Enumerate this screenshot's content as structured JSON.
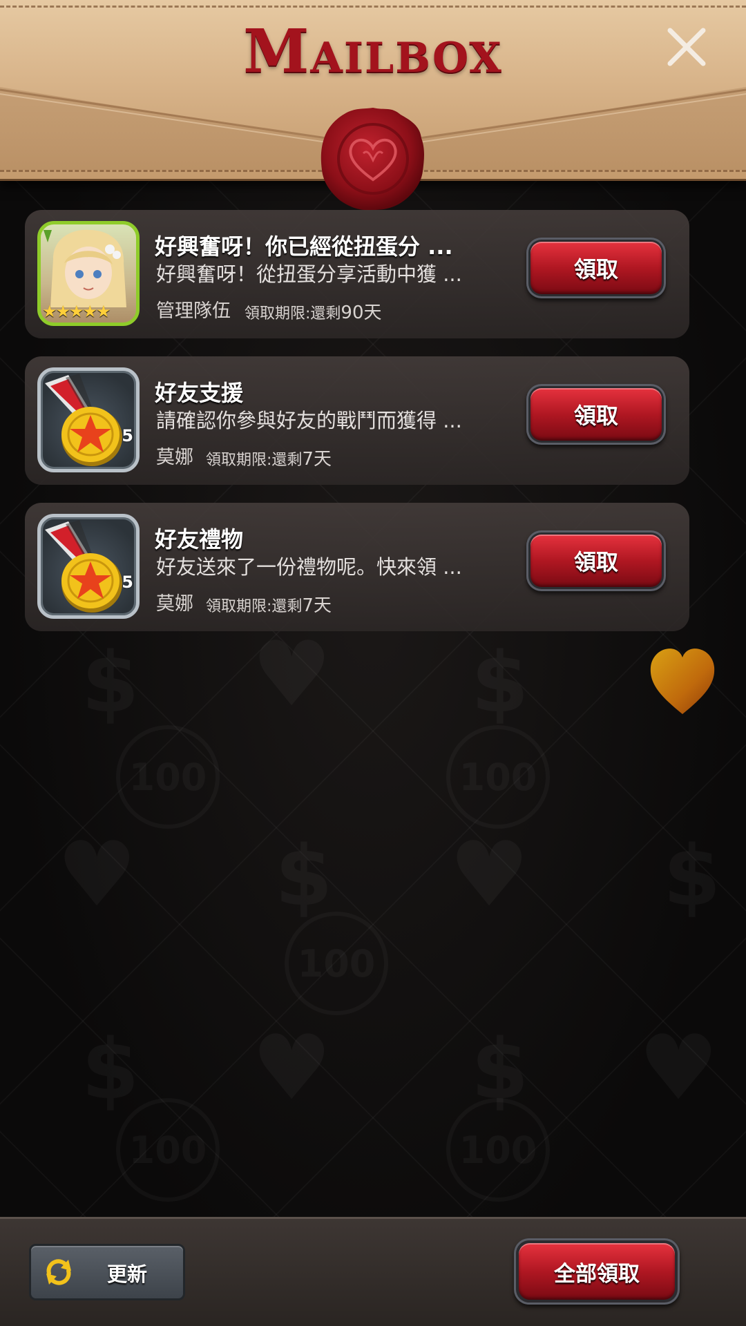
{
  "header": {
    "title": "Mailbox",
    "close_icon": "close-icon",
    "seal_icon": "wax-seal-heart-icon"
  },
  "mails": [
    {
      "title": "好興奮呀！你已經從扭蛋分 ...",
      "description": "好興奮呀！從扭蛋分享活動中獲 ...",
      "sender": "管理隊伍",
      "expiry_label": "領取期限:還剩",
      "expiry_days": "90天",
      "claim_label": "領取",
      "icon": "hero-portrait-icon",
      "stars": "★★★★★"
    },
    {
      "title": "好友支援",
      "description": "請確認你參與好友的戰鬥而獲得 ...",
      "sender": "莫娜",
      "expiry_label": "領取期限:還剩",
      "expiry_days": "7天",
      "claim_label": "領取",
      "icon": "gold-medal-icon",
      "badge": "5"
    },
    {
      "title": "好友禮物",
      "description": "好友送來了一份禮物呢。快來領 ...",
      "sender": "莫娜",
      "expiry_label": "領取期限:還剩",
      "expiry_days": "7天",
      "claim_label": "領取",
      "icon": "gold-medal-icon",
      "badge": "5"
    }
  ],
  "footer": {
    "refresh_label": "更新",
    "refresh_icon": "refresh-icon",
    "claim_all_label": "全部領取"
  },
  "colors": {
    "title_red": "#a3131d",
    "button_red": "#b01722",
    "parchment": "#d8b48a",
    "hero_frame_green": "#8fcc2a",
    "medal_gold": "#f2c21b"
  }
}
